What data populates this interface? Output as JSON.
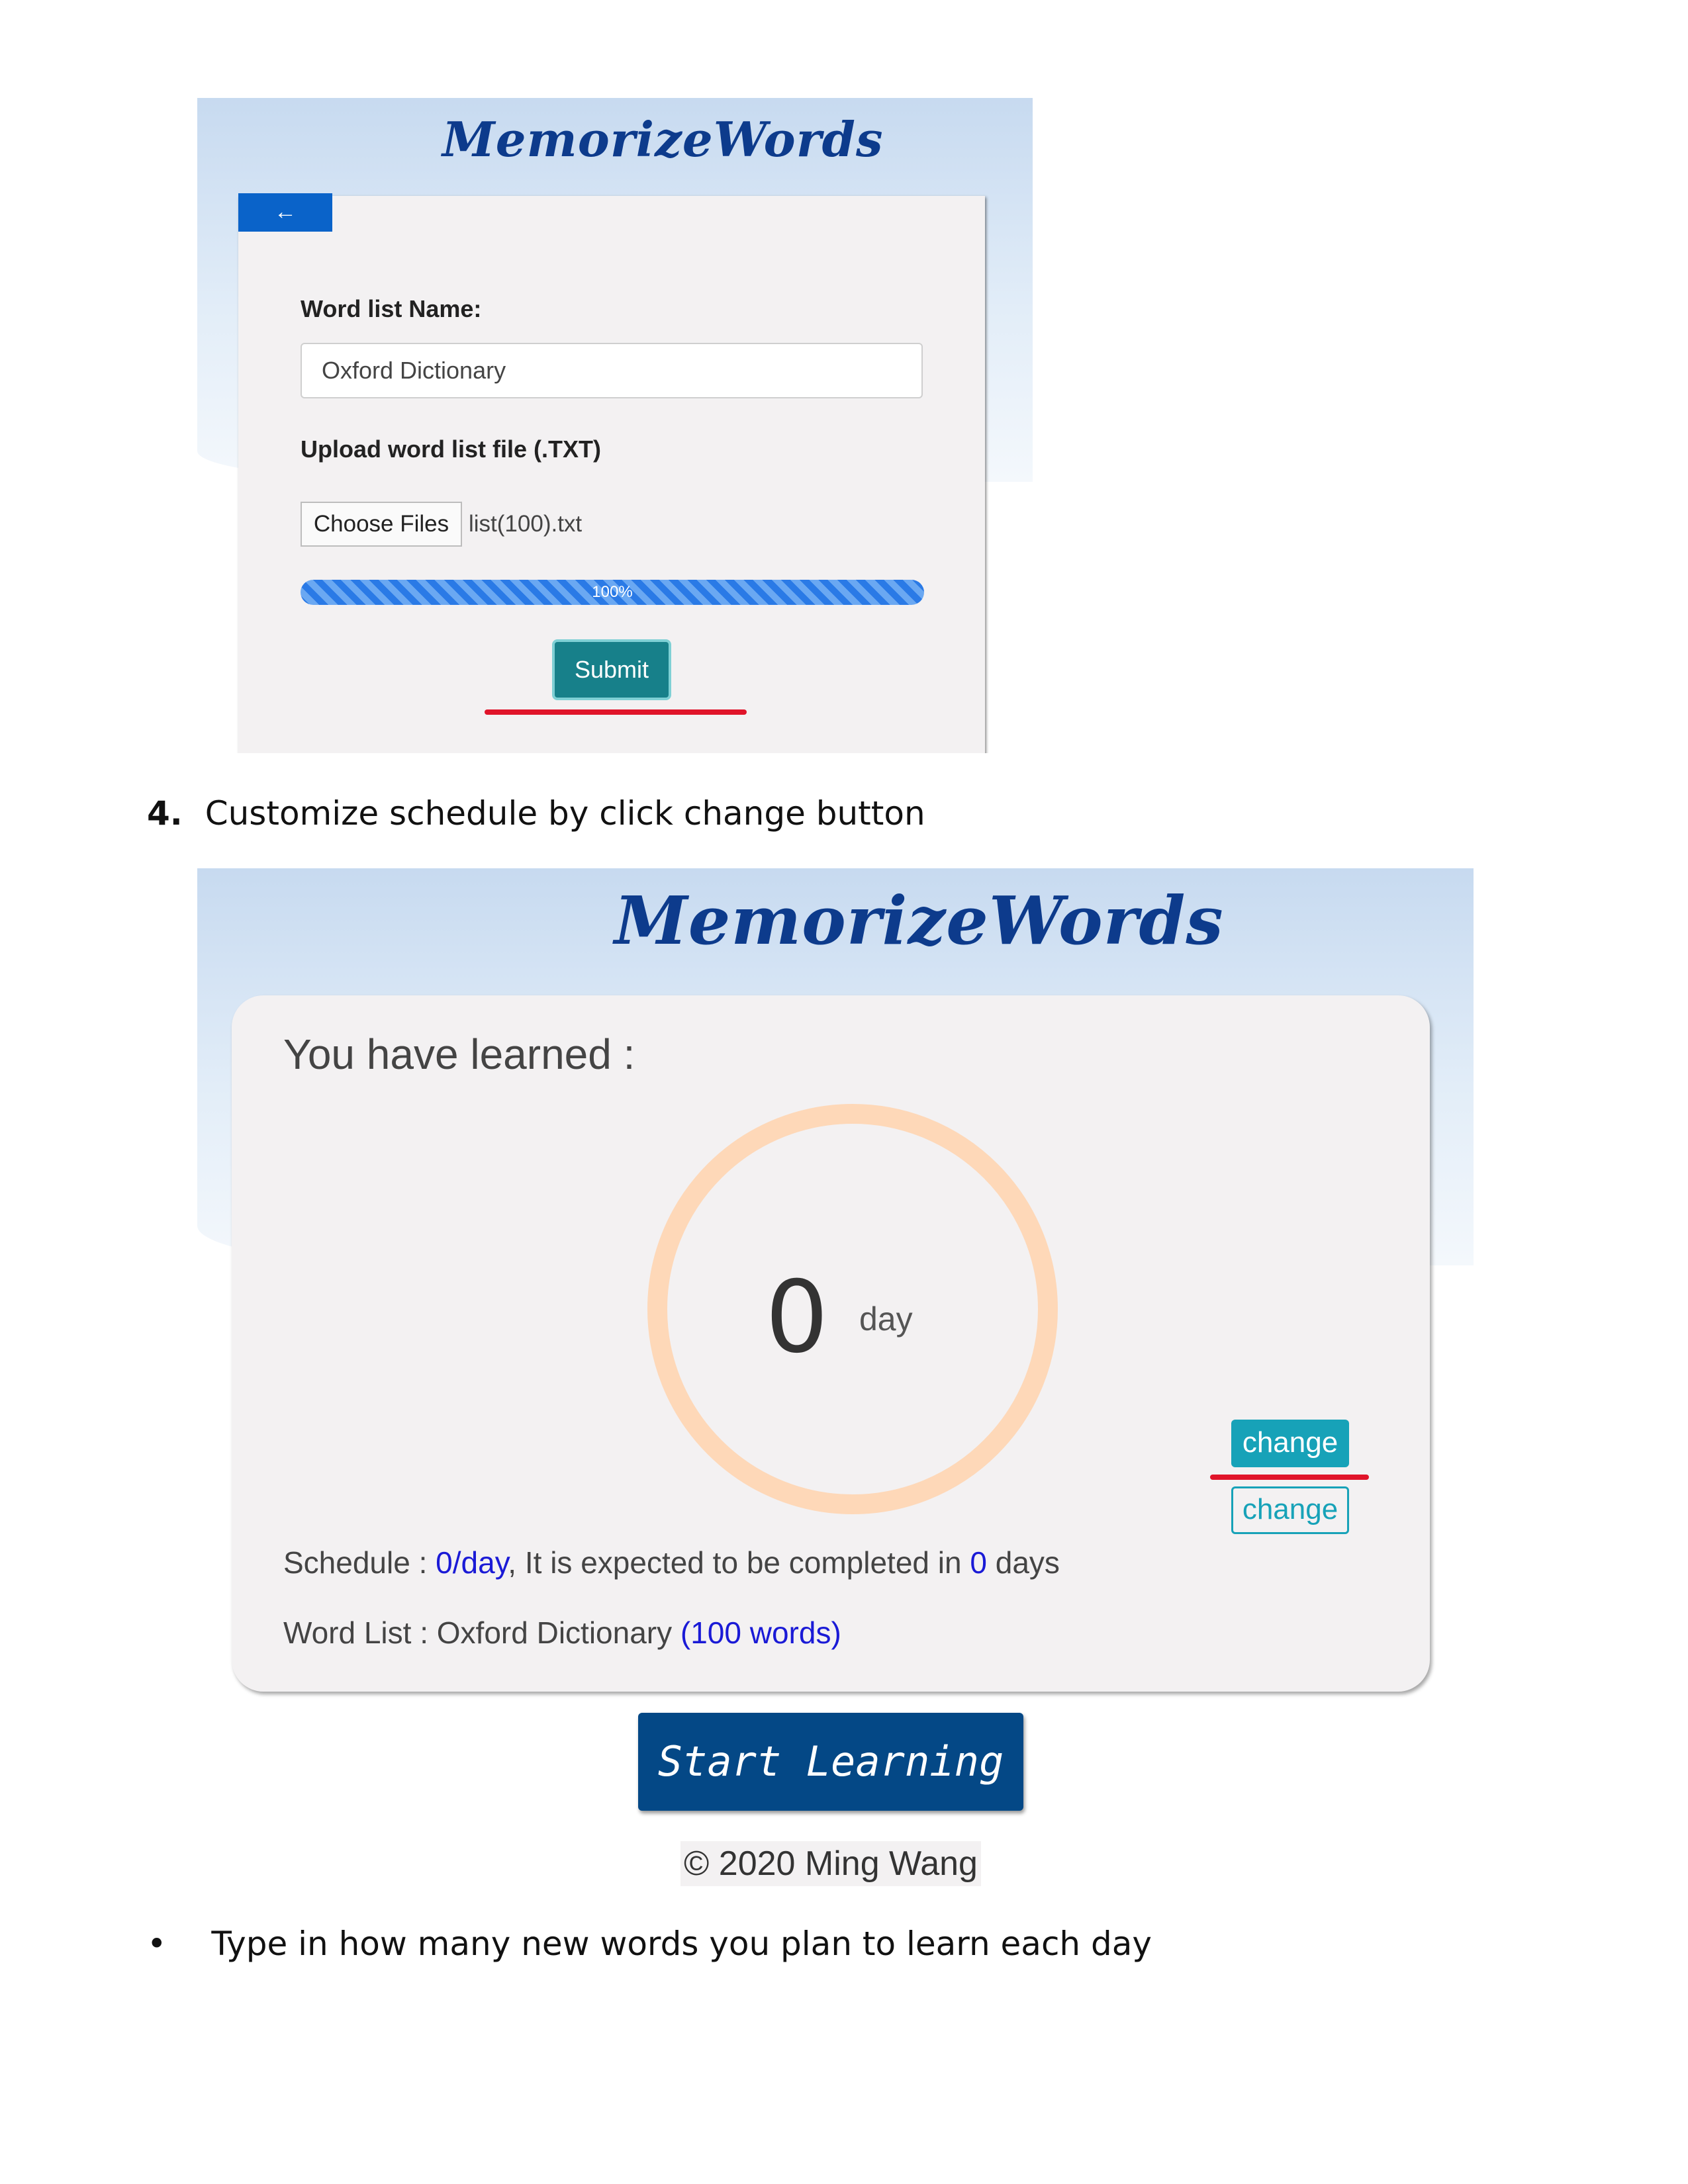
{
  "shot1": {
    "logo": "MemorizeWords",
    "back_button": "←",
    "word_list_name_label": "Word list Name:",
    "word_list_name_value": "Oxford Dictionary",
    "upload_label": "Upload word list file (.TXT)",
    "choose_files_button": "Choose Files",
    "file_name": "list(100).txt",
    "progress_label": "100%",
    "progress_value": 1.0,
    "submit_button": "Submit"
  },
  "step4": {
    "number": "4.",
    "text": "Customize schedule by click change button"
  },
  "shot2": {
    "logo": "MemorizeWords",
    "learned_title": "You have learned :",
    "day_count": "0",
    "day_unit": "day",
    "schedule_prefix": "Schedule : ",
    "schedule_rate": "0/day",
    "schedule_middle": ", It is expected to be completed in ",
    "schedule_days": "0",
    "schedule_suffix": " days",
    "wordlist_prefix": "Word List : Oxford Dictionary ",
    "wordlist_count": "(100 words)",
    "change_button": "change",
    "change_button_2": "change",
    "start_button": "Start Learning",
    "copyright": "© 2020 Ming Wang"
  },
  "bullet": {
    "symbol": "•",
    "text": "Type in how many new words you plan to learn each day"
  },
  "colors": {
    "accent_teal": "#17a2b8",
    "submit_teal": "#17808a",
    "start_navy": "#044886",
    "back_blue": "#0a63c9",
    "highlight_red": "#e0142a",
    "ring_peach": "#fed8b8",
    "link_blue": "#1a1ad6"
  }
}
